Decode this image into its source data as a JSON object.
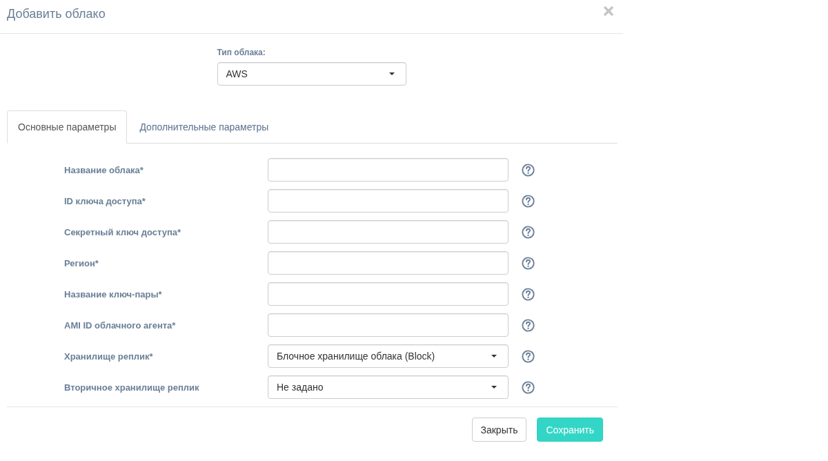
{
  "dialog": {
    "title": "Добавить облако"
  },
  "cloud_type": {
    "label": "Тип облака:",
    "value": "AWS"
  },
  "tabs": [
    {
      "label": "Основные параметры",
      "selected": true
    },
    {
      "label": "Дополнительные параметры",
      "selected": false
    }
  ],
  "fields": [
    {
      "label": "Название облака*",
      "kind": "text"
    },
    {
      "label": "ID ключа доступа*",
      "kind": "text"
    },
    {
      "label": "Секретный ключ доступа*",
      "kind": "text"
    },
    {
      "label": "Регион*",
      "kind": "text"
    },
    {
      "label": "Название ключ-пары*",
      "kind": "text"
    },
    {
      "label": "AMI ID облачного агента*",
      "kind": "text"
    },
    {
      "label": "Хранилище реплик*",
      "kind": "select",
      "value": "Блочное хранилище облака (Block)"
    },
    {
      "label": "Вторичное хранилище реплик",
      "kind": "select",
      "value": "Не задано"
    }
  ],
  "buttons": [
    {
      "label": "Закрыть",
      "kind": "default"
    },
    {
      "label": "Сохранить",
      "kind": "primary"
    }
  ]
}
